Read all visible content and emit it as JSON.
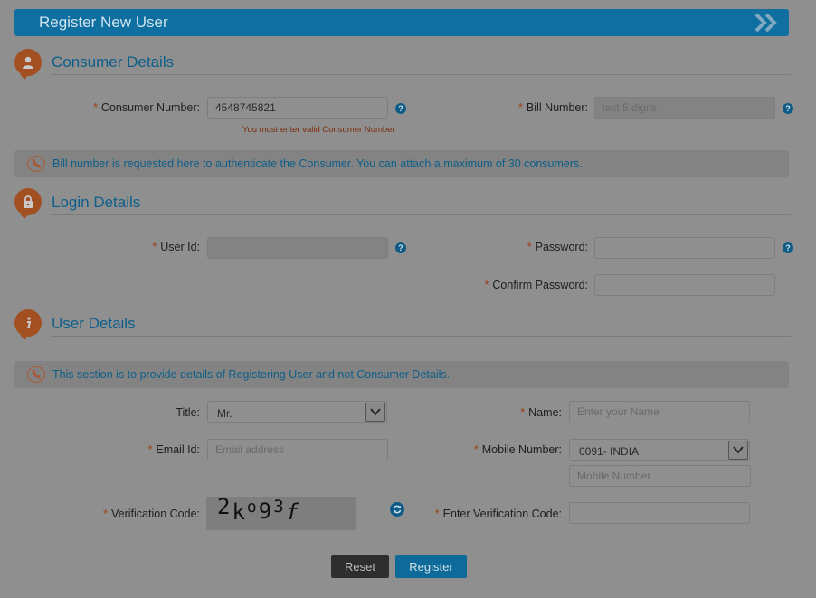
{
  "header": {
    "title": "Register New User"
  },
  "consumer_section": {
    "title": "Consumer Details",
    "consumer_number_label": "Consumer Number:",
    "consumer_number_value": "4548745821",
    "consumer_number_error": "You must enter valid Consumer Number",
    "bill_number_label": "Bill Number:",
    "bill_number_placeholder": "last 5 digits",
    "info": "Bill number is requested here to authenticate the Consumer. You can attach a maximum of 30 consumers."
  },
  "login_section": {
    "title": "Login Details",
    "user_id_label": "User Id:",
    "password_label": "Password:",
    "confirm_password_label": "Confirm Password:"
  },
  "user_section": {
    "title": "User Details",
    "info": "This section is to provide details of Registering User and not Consumer Details.",
    "title_label": "Title:",
    "title_value": "Mr.",
    "name_label": "Name:",
    "name_placeholder": "Enter your Name",
    "email_label": "Email Id:",
    "email_placeholder": "Email address",
    "mobile_label": "Mobile Number:",
    "country_code_value": "0091- INDIA",
    "mobile_placeholder": "Mobile Number",
    "verification_label": "Verification Code:",
    "captcha_text": [
      "2",
      "k",
      "o",
      "9",
      "3",
      "f"
    ],
    "enter_verification_label": "Enter Verification Code:"
  },
  "buttons": {
    "reset": "Reset",
    "register": "Register"
  },
  "help_glyph": "?",
  "required_mark": "*",
  "colors": {
    "header": "#0f6fa0",
    "section_title": "#0d5f8a",
    "icon_orange": "#a24f22",
    "register_button": "#0e6a98",
    "reset_button": "#2e2e2e"
  },
  "icons": {
    "consumer": "user-icon",
    "login": "lock-icon",
    "user": "info-icon",
    "info_bar": "no-phone-icon"
  }
}
